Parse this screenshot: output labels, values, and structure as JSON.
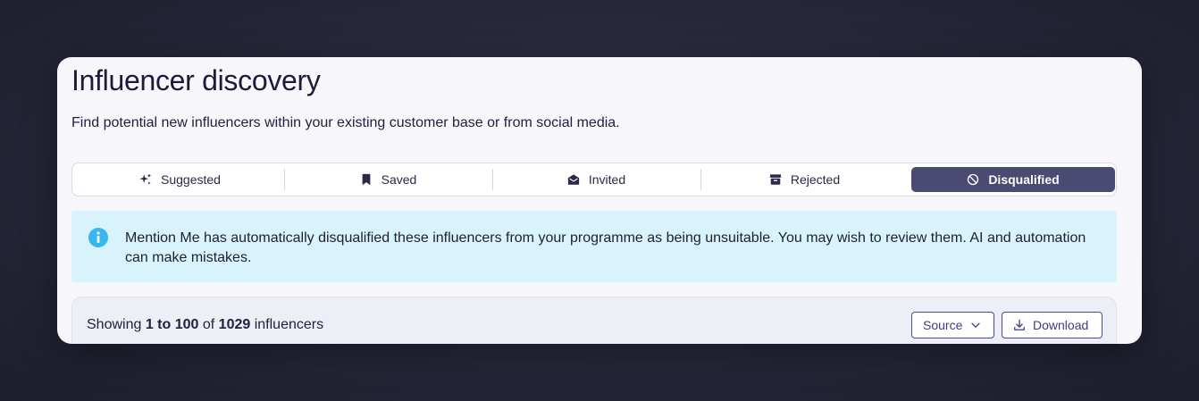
{
  "page": {
    "title": "Influencer discovery",
    "subtitle": "Find potential new influencers within your existing customer base or from social media."
  },
  "tabs": [
    {
      "label": "Suggested",
      "icon": "sparkle-icon",
      "active": false
    },
    {
      "label": "Saved",
      "icon": "bookmark-icon",
      "active": false
    },
    {
      "label": "Invited",
      "icon": "envelope-icon",
      "active": false
    },
    {
      "label": "Rejected",
      "icon": "archive-icon",
      "active": false
    },
    {
      "label": "Disqualified",
      "icon": "ban-icon",
      "active": true
    }
  ],
  "info_banner": {
    "icon": "info-icon",
    "text": "Mention Me has automatically disqualified these influencers from your programme as being unsuitable. You may wish to review them. AI and automation can make mistakes."
  },
  "results": {
    "prefix": "Showing",
    "range": "1 to 100",
    "of": "of",
    "total": "1029",
    "suffix": "influencers",
    "source_button": {
      "label": "Source",
      "icon": "chevron-down-icon"
    },
    "download_button": {
      "label": "Download",
      "icon": "download-icon"
    }
  },
  "colors": {
    "accent": "#4b4a73",
    "info_bg": "#d8f3fb",
    "info_icon": "#38b6f0",
    "button_border": "#4b4a8c"
  }
}
